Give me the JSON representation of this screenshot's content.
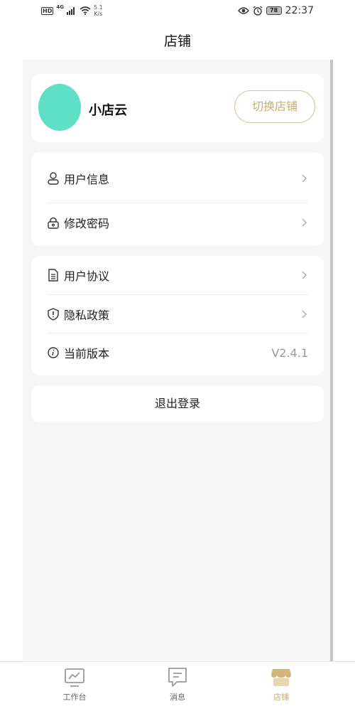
{
  "status_bar": {
    "hd": "HD",
    "network": "4G",
    "speed_value": "5.1",
    "speed_unit": "K/s",
    "battery": "78",
    "time": "22:37"
  },
  "header": {
    "title": "店铺"
  },
  "shop": {
    "name": "小店云",
    "avatar_color": "#5ee0c6",
    "switch_label": "切换店铺"
  },
  "menu_group_1": [
    {
      "label": "用户信息",
      "icon": "user-icon"
    },
    {
      "label": "修改密码",
      "icon": "lock-icon"
    }
  ],
  "menu_group_2": [
    {
      "label": "用户协议",
      "icon": "document-icon"
    },
    {
      "label": "隐私政策",
      "icon": "shield-icon"
    },
    {
      "label": "当前版本",
      "icon": "info-icon",
      "value": "V2.4.1"
    }
  ],
  "logout_label": "退出登录",
  "tabs": [
    {
      "label": "工作台",
      "icon": "dashboard-icon",
      "active": false
    },
    {
      "label": "消息",
      "icon": "message-icon",
      "active": false
    },
    {
      "label": "店铺",
      "icon": "shop-icon",
      "active": true
    }
  ],
  "colors": {
    "accent": "#c9ae72",
    "accent_border": "#d8c49a",
    "background": "#f6f6f6"
  }
}
